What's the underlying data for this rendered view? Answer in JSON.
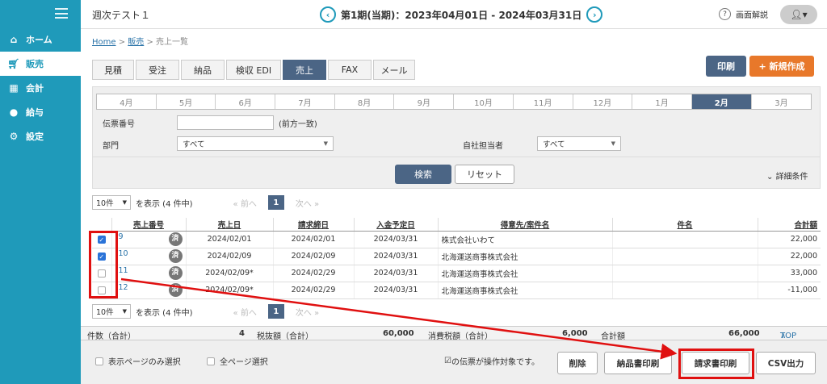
{
  "sidebar": {
    "items": [
      {
        "label": "ホーム",
        "icon": "home-icon"
      },
      {
        "label": "販売",
        "icon": "cart-icon"
      },
      {
        "label": "会計",
        "icon": "calculator-icon"
      },
      {
        "label": "給与",
        "icon": "money-bag-icon"
      },
      {
        "label": "設定",
        "icon": "gear-icon"
      }
    ]
  },
  "header": {
    "company": "週次テスト１",
    "period": "第1期(当期)：2023年04月01日 - 2024年03月31日",
    "help": "画面解説",
    "help_icon": "?"
  },
  "breadcrumb": {
    "home": "Home",
    "sales": "販売",
    "current": "売上一覧"
  },
  "tabs": [
    "見積",
    "受注",
    "納品",
    "検収 EDI",
    "売上",
    "FAX",
    "メール"
  ],
  "actions": {
    "print": "印刷",
    "new": "+ 新規作成"
  },
  "filter": {
    "months": [
      "4月",
      "5月",
      "6月",
      "7月",
      "8月",
      "9月",
      "10月",
      "11月",
      "12月",
      "1月",
      "2月",
      "3月"
    ],
    "selected_month": "2月",
    "slip_label": "伝票番号",
    "slip_hint": "(前方一致)",
    "dept_label": "部門",
    "dept_value": "すべて",
    "staff_label": "自社担当者",
    "staff_value": "すべて",
    "search": "検索",
    "reset": "リセット",
    "detail": "詳細条件"
  },
  "pager": {
    "per_page": "10件",
    "show_text": "を表示 (4 件中)",
    "prev": "« 前へ",
    "page": "1",
    "next": "次へ »"
  },
  "table": {
    "headers": [
      "売上番号",
      "売上日",
      "請求締日",
      "入金予定日",
      "得意先/案件名",
      "件名",
      "合計額"
    ],
    "rows": [
      {
        "checked": true,
        "no": "9",
        "badge": "済",
        "date": "2024/02/01",
        "close": "2024/02/01",
        "due": "2024/03/31",
        "customer": "株式会社いわて",
        "subject": "",
        "total": "22,000"
      },
      {
        "checked": true,
        "no": "10",
        "badge": "済",
        "date": "2024/02/09",
        "close": "2024/02/09",
        "due": "2024/03/31",
        "customer": "北海運送商事株式会社",
        "subject": "",
        "total": "22,000"
      },
      {
        "checked": false,
        "no": "11",
        "badge": "済",
        "date": "2024/02/09*",
        "close": "2024/02/29",
        "due": "2024/03/31",
        "customer": "北海運送商事株式会社",
        "subject": "",
        "total": "33,000"
      },
      {
        "checked": false,
        "no": "12",
        "badge": "済",
        "date": "2024/02/09*",
        "close": "2024/02/29",
        "due": "2024/03/31",
        "customer": "北海運送商事株式会社",
        "subject": "",
        "total": "-11,000"
      }
    ]
  },
  "totals": {
    "count_label": "件数（合計）",
    "count": "4",
    "excl_label": "税抜額（合計）",
    "excl": "60,000",
    "tax_label": "消費税額（合計）",
    "tax": "6,000",
    "sum_label": "合計額",
    "sum": "66,000",
    "top": "TOP"
  },
  "footer": {
    "page_only": "表示ページのみ選択",
    "all_pages": "全ページ選択",
    "target_text": "の伝票が操作対象です。",
    "delete": "削除",
    "delivery_print": "納品書印刷",
    "invoice_print": "請求書印刷",
    "csv": "CSV出力"
  },
  "colors": {
    "sidebar": "#1f9aba",
    "accent": "#4b6585",
    "new_button": "#e8782a",
    "annotation": "#e01010"
  }
}
